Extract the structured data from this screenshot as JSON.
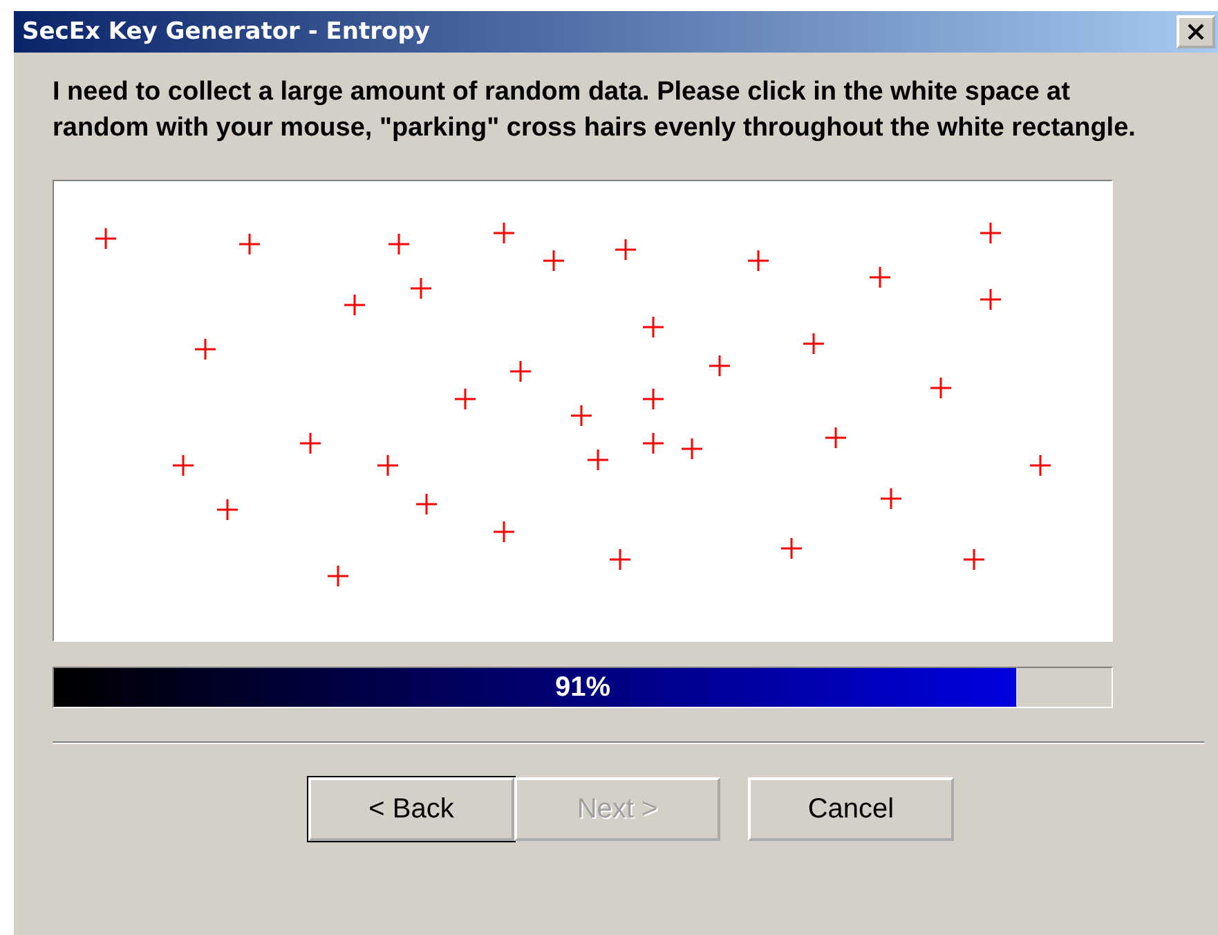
{
  "window": {
    "title": "SecEx Key Generator - Entropy"
  },
  "instructions": "I need to collect a large amount of random data. Please click in the white space at random with your mouse, \"parking\" cross hairs evenly throughout the white rectangle.",
  "progress": {
    "level": 0.91,
    "label": "91%"
  },
  "buttons": [
    {
      "label": "< Back",
      "disabled": false
    },
    {
      "label": "Next >",
      "disabled": true
    },
    {
      "label": "Cancel",
      "disabled": false
    }
  ]
}
